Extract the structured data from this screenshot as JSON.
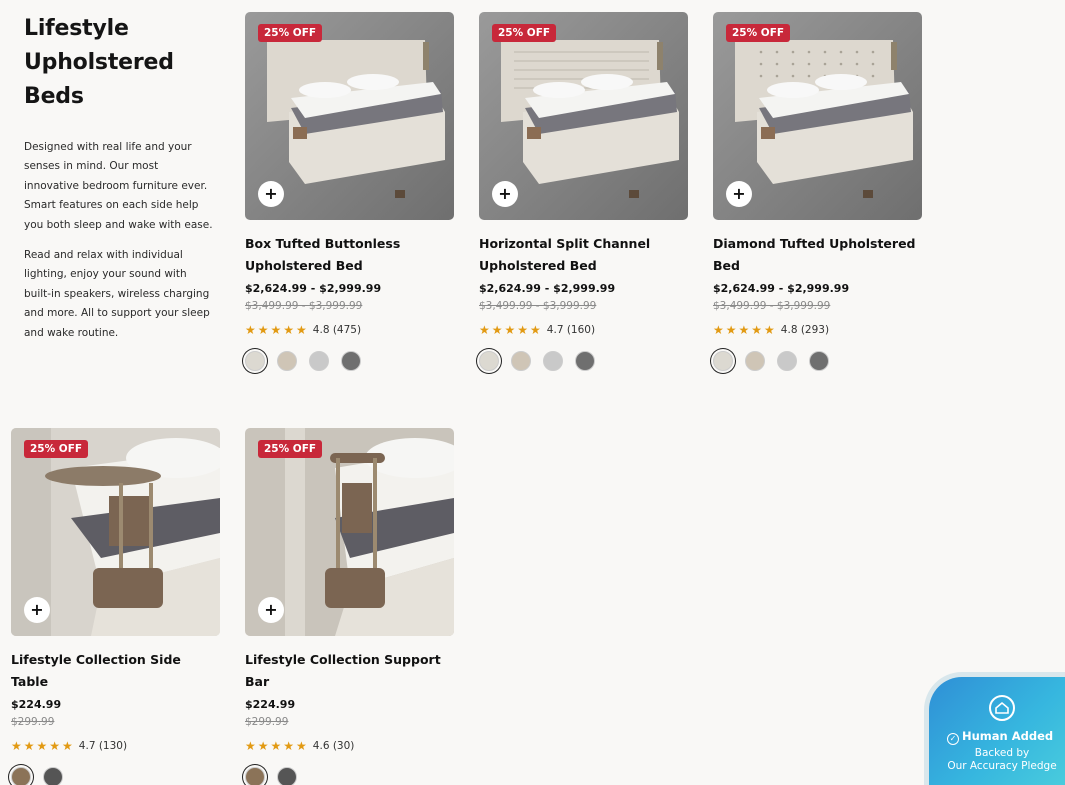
{
  "intro": {
    "title": "Lifestyle\nUpholstered\nBeds",
    "p1": "Designed with real life and your senses in mind. Our most innovative bedroom furniture ever. Smart features on each side help you both sleep and wake with ease.",
    "p2": "Read and relax with individual lighting, enjoy your sound with built-in speakers, wireless charging and more. All to support your sleep and wake routine."
  },
  "products": [
    {
      "badge": "25% OFF",
      "title": "Box Tufted Buttonless Upholstered Bed",
      "price": "$2,624.99 - $2,999.99",
      "old_price": "$3,499.99 - $3,999.99",
      "rating": "4.8 (475)",
      "stars": "★★★★★",
      "swatches": [
        "#dcd9d1",
        "#cfc5b6",
        "#c9c9c9",
        "#6f6f6f"
      ],
      "kind": "bed-box"
    },
    {
      "badge": "25% OFF",
      "title": "Horizontal Split Channel Upholstered Bed",
      "price": "$2,624.99 - $2,999.99",
      "old_price": "$3,499.99 - $3,999.99",
      "rating": "4.7 (160)",
      "stars": "★★★★★",
      "swatches": [
        "#dcd9d1",
        "#cfc5b6",
        "#c9c9c9",
        "#6f6f6f"
      ],
      "kind": "bed-channel"
    },
    {
      "badge": "25% OFF",
      "title": "Diamond Tufted Upholstered Bed",
      "price": "$2,624.99 - $2,999.99",
      "old_price": "$3,499.99 - $3,999.99",
      "rating": "4.8 (293)",
      "stars": "★★★★★",
      "swatches": [
        "#dcd9d1",
        "#cfc5b6",
        "#c9c9c9",
        "#6f6f6f"
      ],
      "kind": "bed-diamond"
    },
    {
      "badge": "25% OFF",
      "title": "Lifestyle Collection Side Table",
      "price": "$224.99",
      "old_price": "$299.99",
      "rating": "4.7 (130)",
      "stars": "★★★★★",
      "swatches": [
        "#8b7358",
        "#555555"
      ],
      "kind": "side-table"
    },
    {
      "badge": "25% OFF",
      "title": "Lifestyle Collection Support Bar",
      "price": "$224.99",
      "old_price": "$299.99",
      "rating": "4.6 (30)",
      "stars": "★★★★★",
      "swatches": [
        "#8b7358",
        "#555555"
      ],
      "kind": "support-bar"
    }
  ],
  "pledge": {
    "headline": "Human Added",
    "sub": "Backed by\nOur Accuracy Pledge"
  },
  "icons": {
    "add": "plus-icon",
    "check": "check-circle-icon",
    "house": "house-icon"
  }
}
